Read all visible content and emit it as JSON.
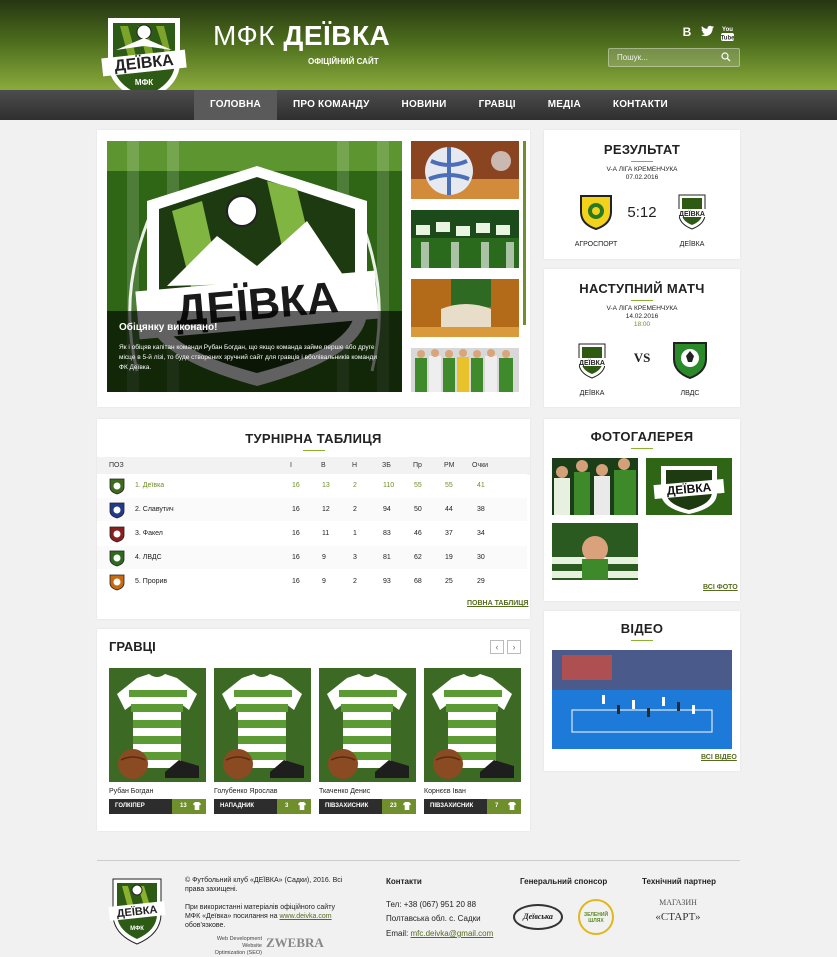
{
  "header": {
    "brand_prefix": "МФК",
    "brand_name": "ДЕЇВКА",
    "subtitle": "ОФІЦІЙНИЙ САЙТ",
    "logo_text": "ДЕЇВКА",
    "logo_sub": "МФК",
    "search_placeholder": "Пошук...",
    "social": [
      {
        "icon": "vk-icon",
        "glyph": "B"
      },
      {
        "icon": "twitter-icon",
        "glyph": "🐦"
      },
      {
        "icon": "youtube-icon",
        "glyph": "▶"
      }
    ]
  },
  "nav": {
    "items": [
      "ГОЛОВНА",
      "ПРО КОМАНДУ",
      "НОВИНИ",
      "ГРАВЦІ",
      "МЕДІА",
      "КОНТАКТИ"
    ],
    "active": 0
  },
  "slider": {
    "title": "Обіцянку виконано!",
    "text": "Як і обіцяв капітан команди Рубан Богдан, що якщо команда займе перше або друге місце в 5-й лізі, то буде створених зручний сайт для гравців і вболівальників команди ФК Деївка.",
    "logo_text": "ДЕЇВКА"
  },
  "result": {
    "title": "РЕЗУЛЬТАТ",
    "league": "V-А ЛІГА КРЕМЕНЧУКА",
    "date": "07.02.2016",
    "score": "5:12",
    "home": "АГРОСПОРТ",
    "away": "ДЕЇВКА"
  },
  "next_match": {
    "title": "НАСТУПНИЙ МАТЧ",
    "league": "V-А ЛІГА КРЕМЕНЧУКА",
    "date": "14.02.2016",
    "time": "18:00",
    "vs": "VS",
    "home": "ДЕЇВКА",
    "away": "ЛВДС"
  },
  "standings": {
    "title": "ТУРНІРНА ТАБЛИЦЯ",
    "headers": [
      "ПОЗ",
      "І",
      "В",
      "Н",
      "ЗБ",
      "Пр",
      "РМ",
      "Очки"
    ],
    "rows": [
      {
        "name": "1. Деївка",
        "i": "16",
        "v": "13",
        "n": "2",
        "zb": "110",
        "pr": "55",
        "rm": "55",
        "pts": "41",
        "color": "#3f6b1f",
        "highlight": true
      },
      {
        "name": "2. Славутич",
        "i": "16",
        "v": "12",
        "n": "2",
        "zb": "94",
        "pr": "50",
        "rm": "44",
        "pts": "38",
        "color": "#1f3b8a",
        "highlight": false
      },
      {
        "name": "3. Факел",
        "i": "16",
        "v": "11",
        "n": "1",
        "zb": "83",
        "pr": "46",
        "rm": "37",
        "pts": "34",
        "color": "#8a1f1f",
        "highlight": false
      },
      {
        "name": "4. ЛВДС",
        "i": "16",
        "v": "9",
        "n": "3",
        "zb": "81",
        "pr": "62",
        "rm": "19",
        "pts": "30",
        "color": "#2f6b1f",
        "highlight": false
      },
      {
        "name": "5. Прорив",
        "i": "16",
        "v": "9",
        "n": "2",
        "zb": "93",
        "pr": "68",
        "rm": "25",
        "pts": "29",
        "color": "#c86a10",
        "highlight": false
      }
    ],
    "full_link": "ПОВНА ТАБЛИЦЯ"
  },
  "players": {
    "title": "ГРАВЦІ",
    "list": [
      {
        "name": "Рубан Богдан",
        "position": "ГОЛКІПЕР",
        "number": "13"
      },
      {
        "name": "Голубенко Ярослав",
        "position": "НАПАДНИК",
        "number": "3"
      },
      {
        "name": "Ткаченко Денис",
        "position": "ПІВЗАХИСНИК",
        "number": "23"
      },
      {
        "name": "Корнєєв Іван",
        "position": "ПІВЗАХИСНИК",
        "number": "7"
      }
    ]
  },
  "gallery": {
    "title": "ФОТОГАЛЕРЕЯ",
    "link": "ВСІ ФОТО"
  },
  "video": {
    "title": "ВІДЕО",
    "link": "ВСІ ВІДЕО"
  },
  "footer": {
    "copyright": "© Футбольний клуб «ДЕЇВКА» (Садки), 2016. Всі права захищені.",
    "note": "При використанні матеріалів офіційного сайту МФК «Деївка» посилання на",
    "note_link": "www.deivka.com",
    "note_end": "обов'язкове.",
    "dev1": "Web Development",
    "dev2": "Website Optimization (SEO)",
    "dev_brand": "ZWEBRA",
    "contacts_title": "Контакти",
    "phone": "Тел: +38 (067) 951 20 88",
    "address": "Полтавська обл. с. Садки",
    "email_label": "Email:",
    "email": "mfc.deivka@gmail.com",
    "sponsor_title": "Генеральний спонсор",
    "sponsor1": "Деївська",
    "sponsor2": "ЗЕЛЕНИЙ ШЛЯХ",
    "partner_title": "Технічний партнер",
    "partner1": "МАГАЗИН",
    "partner2": "«СТАРТ»"
  },
  "colors": {
    "accent": "#8bb22f",
    "dark_green": "#3f6b1f",
    "nav": "#3a3a3a"
  }
}
